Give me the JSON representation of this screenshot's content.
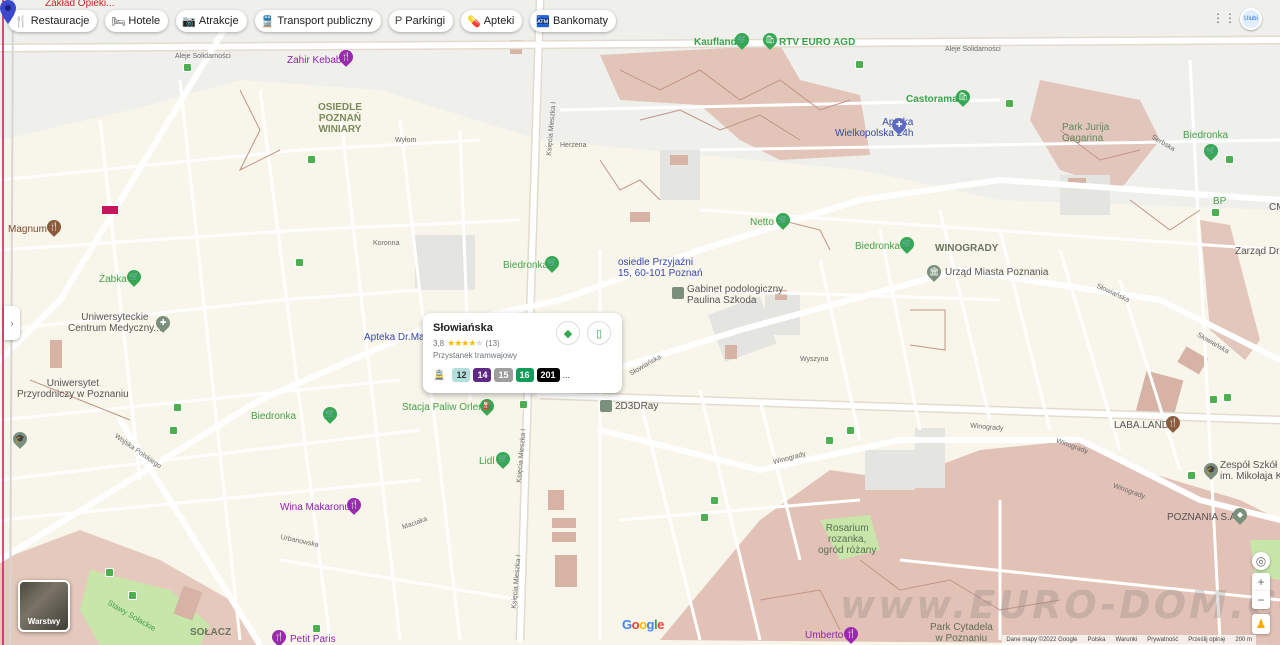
{
  "chips": [
    {
      "icon": "restaurant-icon",
      "glyph": "🍴",
      "label": "Restauracje"
    },
    {
      "icon": "hotel-icon",
      "glyph": "🛏",
      "label": "Hotele"
    },
    {
      "icon": "attractions-icon",
      "glyph": "📷",
      "label": "Atrakcje"
    },
    {
      "icon": "transit-icon",
      "glyph": "🚆",
      "label": "Transport publiczny"
    },
    {
      "icon": "parking-icon",
      "glyph": "P",
      "label": "Parkingi"
    },
    {
      "icon": "pharmacy-icon",
      "glyph": "💊",
      "label": "Apteki"
    },
    {
      "icon": "atm-icon",
      "glyph": "🏧",
      "label": "Bankomaty"
    }
  ],
  "top_partial": "Zakład Opieki...",
  "selected_place": {
    "address_line1": "osiedle Przyjaźni",
    "address_line2": "15, 60-101 Poznań"
  },
  "card": {
    "title": "Słowiańska",
    "rating": "3,8",
    "reviews": "(13)",
    "category": "Przystanek tramwajowy",
    "lines": [
      {
        "num": "12",
        "bg": "#b2dfdb",
        "fg": "#333333"
      },
      {
        "num": "14",
        "bg": "#5e2a84",
        "fg": "#ffffff"
      },
      {
        "num": "15",
        "bg": "#9e9e9e",
        "fg": "#ffffff"
      },
      {
        "num": "16",
        "bg": "#0f9d58",
        "fg": "#ffffff"
      },
      {
        "num": "201",
        "bg": "#000000",
        "fg": "#ffffff"
      }
    ],
    "more": "..."
  },
  "poi": {
    "zahir": "Zahir Kebab",
    "kaufland": "Kaufland",
    "rtv": "RTV EURO AGD",
    "castorama": "Castorama",
    "apteka_wlkp_1": "Apteka",
    "apteka_wlkp_2": "Wielkopolska 24h",
    "park_gagarina_1": "Park Jurija",
    "park_gagarina_2": "Gagarina",
    "biedronka": "Biedronka",
    "magnum": "Magnum",
    "zabka": "Żabka",
    "netto": "Netto",
    "winogrady": "WINOGRADY",
    "urzad": "Urząd Miasta Poznania",
    "gabinet_1": "Gabinet podologiczny",
    "gabinet_2": "Paulina Szkoda",
    "ucm_1": "Uniwersyteckie",
    "ucm_2": "Centrum Medyczny...",
    "apteka_dr": "Apteka Dr.Max",
    "uniw_1": "Uniwersytet",
    "uniw_2": "Przyrodniczy w Poznaniu",
    "orlen": "Stacja Paliw Orlen",
    "ray": "2D3DRay",
    "lidl": "Lidl",
    "laba": "LABA.LAND",
    "zespol_1": "Zespół Szkół L",
    "zespol_2": "im. Mikołaja K",
    "poznania": "POZNANIA S.A",
    "wina": "Wina Makaronu",
    "petit": "Petit Paris",
    "umberto": "Umberto",
    "rosarium_1": "Rosarium",
    "rosarium_2": "rozanka,",
    "rosarium_3": "ogród różany",
    "park_cytadela_1": "Park Cytadela",
    "park_cytadela_2": "w Poznaniu",
    "osiedle_1": "OSIEDLE",
    "osiedle_2": "POZNAŃ",
    "osiedle_3": "WINIARY",
    "solacz": "SOŁACZ",
    "bp": "BP",
    "zarzad": "Zarząd Dró",
    "cm": "CM",
    "stawy": "Stawy Sołackie"
  },
  "streets": {
    "solidarnosci_left": "Aleje Solidarności",
    "solidarnosci_right": "Aleje Solidarności",
    "slowianska": "Słowiańska",
    "winogrady_road": "Winogrady",
    "koscielna": "Kościelna",
    "wojska": "Wojska Polskiego",
    "urbanowska": "Urbanowska",
    "maciaka": "Maciaka",
    "serbska": "Serbska",
    "ul_mieszka_1": "Księcia Mieszka I",
    "ul_mieszka_2": "Księcia Mieszka I",
    "ul_mieszka_3": "Księcia Mieszka I",
    "herzena": "Herzena",
    "wyspa": "Wyłom",
    "koronna": "Koronna",
    "bialoruska": "Białoruska",
    "wystan": "Wyszyna"
  },
  "layers_label": "Warstwy",
  "google_logo": "Google",
  "watermark": "www.EURO-DOM.CO",
  "footer": [
    "Dane mapy ©2022 Google",
    "Polska",
    "Warunki",
    "Prywatność",
    "Prześlij opinię",
    "200 m"
  ],
  "avatar_text": "Ulubi",
  "colors": {
    "map_bg": "#f8f6ea",
    "green_area": "#c8e6a9",
    "brown_area": "#dfbcb0",
    "road": "#ffffff",
    "main_road": "#e8e3d8",
    "pin_selected": "#3b48cc"
  }
}
